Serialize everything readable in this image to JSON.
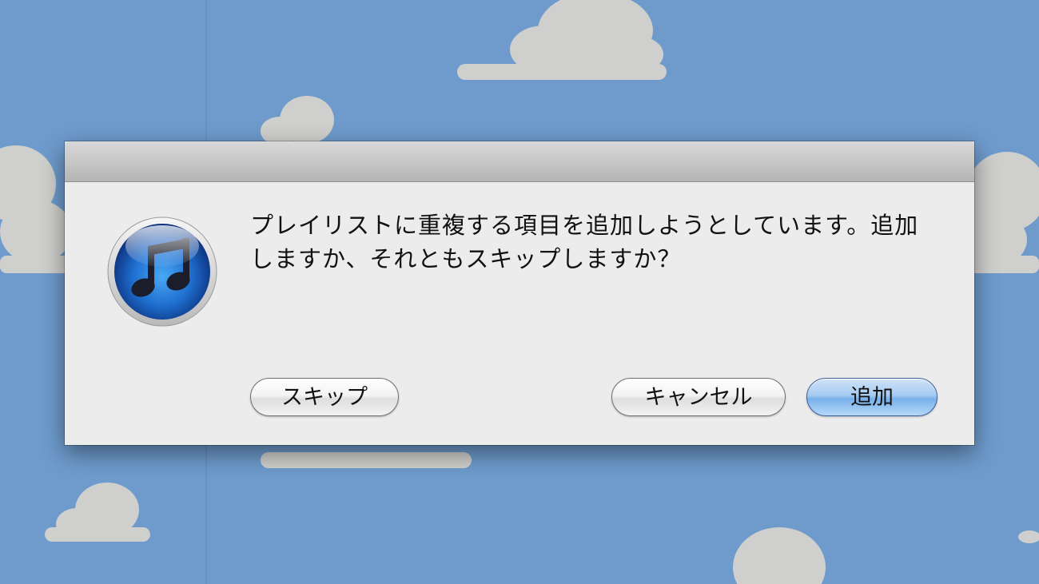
{
  "dialog": {
    "message_line1": "プレイリストに重複する項目を追加しようとしています。追加",
    "message_line2": "しますか、それともスキップしますか？",
    "icon": "itunes-music-note-icon",
    "buttons": {
      "skip_label": "スキップ",
      "cancel_label": "キャンセル",
      "add_label": "追加"
    }
  },
  "colors": {
    "sky": "#6e9bcc",
    "cloud": "#cfcfcd",
    "dialog_bg": "#ececec",
    "default_button": "#8fbdef"
  }
}
